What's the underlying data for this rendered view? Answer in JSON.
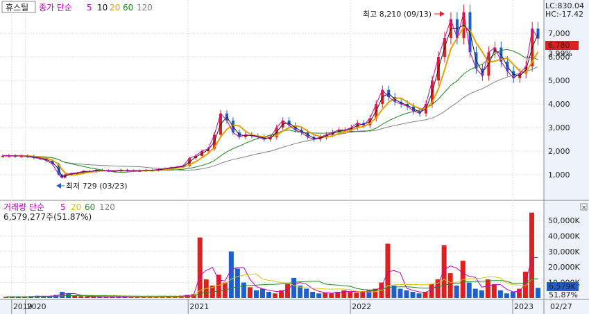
{
  "symbol": "휴스틸",
  "price_legend": {
    "label": "종가 단순",
    "periods": [
      "5",
      "10",
      "20",
      "60",
      "120"
    ],
    "colors": [
      "#c000c0",
      "#1a1a1a",
      "#e8a000",
      "#1a8a1a",
      "#808080"
    ]
  },
  "volume_legend": {
    "label": "거래량 단순",
    "periods": [
      "5",
      "20",
      "60",
      "120"
    ],
    "colors": [
      "#c000c0",
      "#d8c800",
      "#1a8a1a",
      "#808080"
    ],
    "summary": "6,579,277주(51.87%)"
  },
  "indicators": {
    "lc": "LC:830.04",
    "hc": "HC:-17.42"
  },
  "current": {
    "price_label": "6,780",
    "change_label": "3.99%",
    "value": 6780
  },
  "current_volume": {
    "label": "6,579K",
    "ratio": "51.87%",
    "value": 6579
  },
  "annotations": {
    "high": {
      "text": "최고 8,210 (09/13)",
      "value": 8210
    },
    "low": {
      "text": "최저 729 (03/23)",
      "value": 729
    }
  },
  "date_label": "02/27",
  "colors": {
    "up": "#e02020",
    "down": "#1e5fd0",
    "current_bg": "#e02020"
  },
  "chart_data": [
    {
      "type": "candlestick",
      "title": "",
      "ylim": [
        0,
        8300
      ],
      "y_ticks": [
        1000,
        2000,
        3000,
        4000,
        5000,
        6000,
        7000
      ],
      "y_tick_labels": [
        "1,000",
        "2,000",
        "3,000",
        "4,000",
        "5,000",
        "6,000",
        "7,000"
      ],
      "x_ticks": [
        "2019",
        "2020",
        "2021",
        "2022",
        "2023"
      ],
      "x_tick_dates": [
        "2019-12-01",
        "2020-01-01",
        "2021-01-01",
        "2022-01-01",
        "2023-01-01"
      ],
      "x_range": [
        "2019-11-11",
        "2023-03-06"
      ],
      "grid": true,
      "candles": [
        [
          "2019-11-11",
          1800
        ],
        [
          "2019-11-25",
          1810
        ],
        [
          "2019-12-09",
          1790
        ],
        [
          "2019-12-23",
          1800
        ],
        [
          "2020-01-06",
          1780
        ],
        [
          "2020-01-20",
          1720
        ],
        [
          "2020-02-03",
          1690
        ],
        [
          "2020-02-17",
          1600
        ],
        [
          "2020-03-02",
          1450
        ],
        [
          "2020-03-16",
          1000
        ],
        [
          "2020-03-23",
          870
        ],
        [
          "2020-03-30",
          1000
        ],
        [
          "2020-04-13",
          1050
        ],
        [
          "2020-04-27",
          1080
        ],
        [
          "2020-05-11",
          1150
        ],
        [
          "2020-05-25",
          1130
        ],
        [
          "2020-06-08",
          1200
        ],
        [
          "2020-06-22",
          1180
        ],
        [
          "2020-07-06",
          1160
        ],
        [
          "2020-07-20",
          1140
        ],
        [
          "2020-08-03",
          1200
        ],
        [
          "2020-08-17",
          1160
        ],
        [
          "2020-08-31",
          1180
        ],
        [
          "2020-09-14",
          1170
        ],
        [
          "2020-09-28",
          1200
        ],
        [
          "2020-10-12",
          1180
        ],
        [
          "2020-10-26",
          1230
        ],
        [
          "2020-11-09",
          1260
        ],
        [
          "2020-11-23",
          1300
        ],
        [
          "2020-12-07",
          1330
        ],
        [
          "2020-12-21",
          1380
        ],
        [
          "2021-01-04",
          1700
        ],
        [
          "2021-01-18",
          1800
        ],
        [
          "2021-02-01",
          2000
        ],
        [
          "2021-02-15",
          2100
        ],
        [
          "2021-03-01",
          2700
        ],
        [
          "2021-03-15",
          3600
        ],
        [
          "2021-03-29",
          3300
        ],
        [
          "2021-04-12",
          2800
        ],
        [
          "2021-04-26",
          2600
        ],
        [
          "2021-05-10",
          2700
        ],
        [
          "2021-05-24",
          2650
        ],
        [
          "2021-06-07",
          2600
        ],
        [
          "2021-06-21",
          2500
        ],
        [
          "2021-07-05",
          2600
        ],
        [
          "2021-07-19",
          3000
        ],
        [
          "2021-08-02",
          3300
        ],
        [
          "2021-08-16",
          3100
        ],
        [
          "2021-08-30",
          2900
        ],
        [
          "2021-09-13",
          2800
        ],
        [
          "2021-09-27",
          2600
        ],
        [
          "2021-10-11",
          2500
        ],
        [
          "2021-10-25",
          2600
        ],
        [
          "2021-11-08",
          2700
        ],
        [
          "2021-11-22",
          2800
        ],
        [
          "2021-12-06",
          2900
        ],
        [
          "2021-12-20",
          2900
        ],
        [
          "2022-01-03",
          3000
        ],
        [
          "2022-01-17",
          3200
        ],
        [
          "2022-01-31",
          3100
        ],
        [
          "2022-02-14",
          3400
        ],
        [
          "2022-02-28",
          4000
        ],
        [
          "2022-03-14",
          4600
        ],
        [
          "2022-03-28",
          4300
        ],
        [
          "2022-04-11",
          4100
        ],
        [
          "2022-04-25",
          4000
        ],
        [
          "2022-05-09",
          3900
        ],
        [
          "2022-05-23",
          3700
        ],
        [
          "2022-06-06",
          3600
        ],
        [
          "2022-06-20",
          4000
        ],
        [
          "2022-07-04",
          5000
        ],
        [
          "2022-07-18",
          6000
        ],
        [
          "2022-08-01",
          6800
        ],
        [
          "2022-08-15",
          7600
        ],
        [
          "2022-08-29",
          6800
        ],
        [
          "2022-09-13",
          7900
        ],
        [
          "2022-09-27",
          6200
        ],
        [
          "2022-10-11",
          5500
        ],
        [
          "2022-10-25",
          5200
        ],
        [
          "2022-11-08",
          6200
        ],
        [
          "2022-11-22",
          6400
        ],
        [
          "2022-12-06",
          5800
        ],
        [
          "2022-12-20",
          5400
        ],
        [
          "2023-01-03",
          5100
        ],
        [
          "2023-01-17",
          5300
        ],
        [
          "2023-01-31",
          5600
        ],
        [
          "2023-02-14",
          7200
        ],
        [
          "2023-02-27",
          6780
        ]
      ]
    },
    {
      "type": "bar",
      "title": "",
      "ylim": [
        0,
        58000
      ],
      "y_ticks": [
        10000,
        20000,
        30000,
        40000,
        50000
      ],
      "y_tick_labels": [
        "10,000K",
        "20,000K",
        "30,000K",
        "40,000K",
        "50,000K"
      ],
      "values": [
        800,
        900,
        800,
        700,
        1200,
        1500,
        1100,
        1300,
        2000,
        4000,
        3000,
        1500,
        1200,
        1000,
        900,
        800,
        700,
        800,
        900,
        700,
        600,
        700,
        600,
        700,
        800,
        900,
        1000,
        1200,
        1500,
        2000,
        2500,
        39000,
        12000,
        8000,
        15000,
        10000,
        30000,
        19000,
        10000,
        7000,
        5000,
        6000,
        4000,
        3000,
        5000,
        9000,
        13000,
        8000,
        6000,
        4000,
        3000,
        3500,
        3000,
        4000,
        5000,
        4000,
        3500,
        4500,
        5000,
        6000,
        10000,
        35000,
        8000,
        6000,
        5000,
        4000,
        3000,
        4000,
        9000,
        12000,
        34000,
        16000,
        8000,
        24000,
        10000,
        6000,
        5000,
        12000,
        9000,
        5000,
        3000,
        4000,
        6000,
        17000,
        55000,
        6579
      ]
    }
  ]
}
